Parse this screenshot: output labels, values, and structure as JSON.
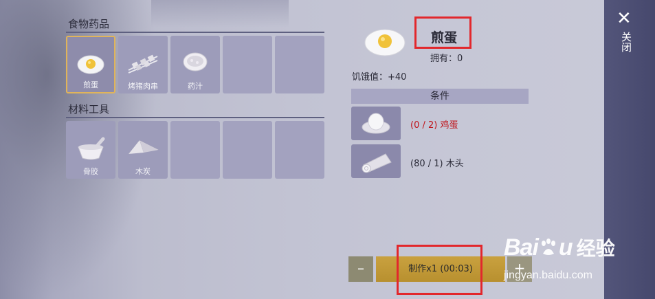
{
  "categories": {
    "food": {
      "title": "食物药品",
      "items": [
        {
          "label": "煎蛋",
          "icon": "fried-egg-icon",
          "selected": true
        },
        {
          "label": "烤猪肉串",
          "icon": "skewer-icon"
        },
        {
          "label": "药汁",
          "icon": "potion-bowl-icon"
        }
      ]
    },
    "materials": {
      "title": "材料工具",
      "items": [
        {
          "label": "骨胶",
          "icon": "mortar-icon"
        },
        {
          "label": "木炭",
          "icon": "charcoal-icon"
        }
      ]
    }
  },
  "detail": {
    "name": "煎蛋",
    "owned": "拥有：0",
    "hunger": "饥饿值：+40",
    "conditions_title": "条件",
    "materials": [
      {
        "text": "(0 / 2) 鸡蛋",
        "icon": "egg-nest-icon",
        "color": "#c0141b"
      },
      {
        "text": "(80 / 1) 木头",
        "icon": "log-icon",
        "color": "#2b2b38"
      }
    ]
  },
  "actions": {
    "minus": "–",
    "make": "制作x1 (00:03)",
    "plus": "+"
  },
  "panel": {
    "close_x": "✕",
    "close_label": "关闭"
  },
  "watermark": {
    "logo": "Bai",
    "logo_tail": "u",
    "cn": "经验",
    "url": "jingyan.baidu.com"
  },
  "colors": {
    "accent_selected": "#e0b45a",
    "make_button": "#c9a13f",
    "highlight_box": "#e2272c",
    "side_panel": "#4b4d72"
  }
}
